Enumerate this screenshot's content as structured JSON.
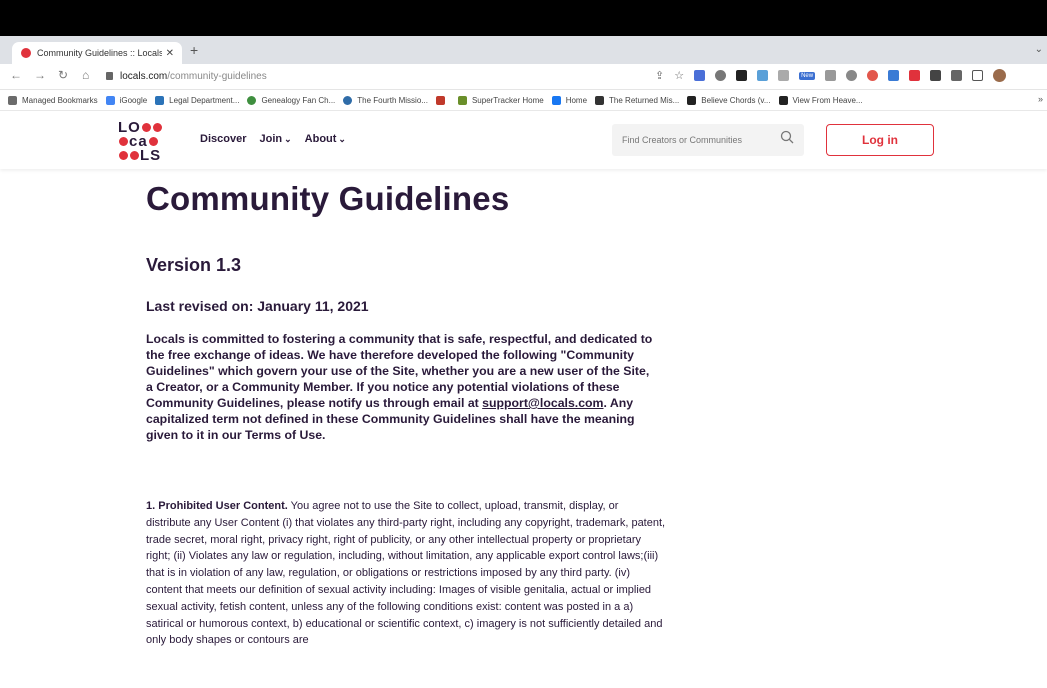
{
  "browser": {
    "tab_title": "Community Guidelines :: Locals",
    "url_domain": "locals.com",
    "url_path": "/community-guidelines",
    "bookmarks": [
      {
        "label": "Managed Bookmarks",
        "color": "#6b6b6b"
      },
      {
        "label": "iGoogle",
        "color": "#4285f4"
      },
      {
        "label": "Legal Department...",
        "color": "#2b73b8"
      },
      {
        "label": "Genealogy Fan Ch...",
        "color": "#3f8f3f"
      },
      {
        "label": "The Fourth Missio...",
        "color": "#2f6ca8"
      },
      {
        "label": "",
        "color": "#c0392b"
      },
      {
        "label": "SuperTracker Home",
        "color": "#6a8f2a"
      },
      {
        "label": "Home",
        "color": "#1877f2"
      },
      {
        "label": "The Returned Mis...",
        "color": "#333333"
      },
      {
        "label": "Believe Chords (v...",
        "color": "#222222"
      },
      {
        "label": "View From Heave...",
        "color": "#222222"
      }
    ],
    "extension_badge": "New"
  },
  "site": {
    "logo_rows": [
      "LO",
      "ca",
      "LS"
    ],
    "nav": {
      "discover": "Discover",
      "join": "Join",
      "about": "About"
    },
    "search_placeholder": "Find Creators or Communities",
    "login_label": "Log in",
    "brand_color": "#e0323c"
  },
  "doc": {
    "title": "Community Guidelines",
    "version": "Version 1.3",
    "revised": "Last revised on: January 11, 2021",
    "intro_before_link": "Locals is committed to fostering a community that is safe, respectful, and dedicated to the free exchange of ideas. We have therefore developed the following \"Community Guidelines\" which govern your use of the Site, whether you are a new user of the Site, a Creator, or a Community Member. If you notice any potential violations of these Community Guidelines, please notify us through email at ",
    "intro_link": "support@locals.com",
    "intro_after_link": ". Any capitalized term not defined in these Community Guidelines shall have the meaning given to it in our Terms of Use.",
    "section1_heading": "1. Prohibited User Content.",
    "section1_body": " You agree not to use the Site to collect, upload, transmit, display, or distribute any User Content (i) that violates any third-party right, including any copyright, trademark, patent, trade secret, moral right, privacy right, right of publicity, or any other intellectual property or proprietary right; (ii) Violates any law or regulation, including, without limitation, any applicable export control laws;(iii) that is in violation of any law, regulation, or obligations or restrictions imposed by any third party. (iv) content that meets our definition of sexual activity including: Images of visible genitalia, actual or implied sexual activity, fetish content, unless any of the following conditions exist: content was posted in a a) satirical or humorous context, b) educational or scientific context, c) imagery is not sufficiently detailed and only body shapes or contours are"
  }
}
